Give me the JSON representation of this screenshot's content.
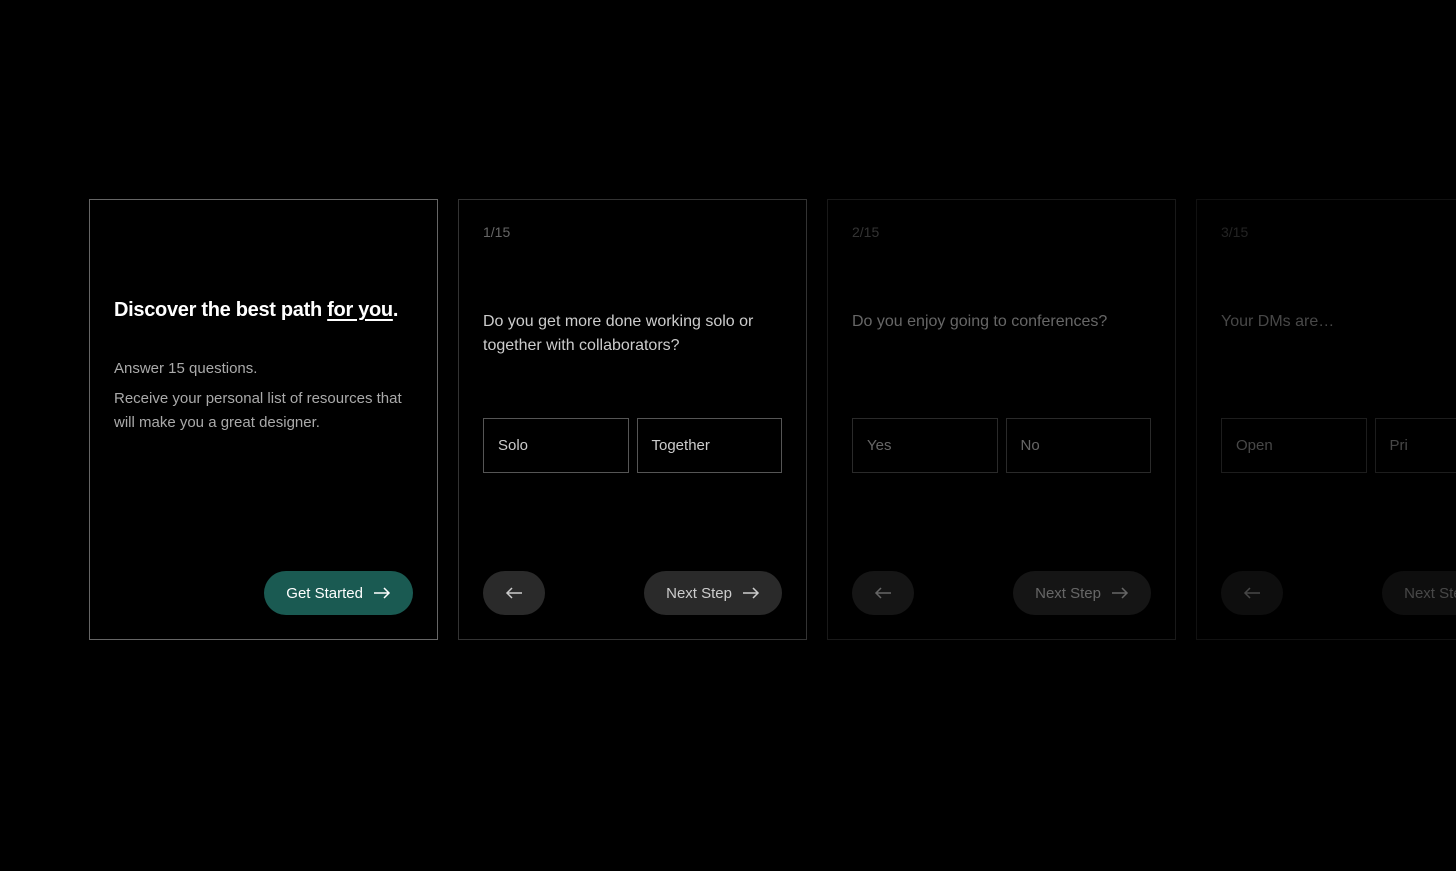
{
  "intro": {
    "title_prefix": "Discover the best path ",
    "title_underline": "for you",
    "title_suffix": ".",
    "line1": "Answer 15 questions.",
    "line2": "Receive your personal list of resources that will make you a great designer.",
    "cta": "Get Started"
  },
  "cards": [
    {
      "progress": "1/15",
      "question": "Do you get more done working solo or together with collaborators?",
      "option_a": "Solo",
      "option_b": "Together",
      "next": "Next Step"
    },
    {
      "progress": "2/15",
      "question": "Do you enjoy going to conferences?",
      "option_a": "Yes",
      "option_b": "No",
      "next": "Next Step"
    },
    {
      "progress": "3/15",
      "question": "Your DMs are…",
      "option_a": "Open",
      "option_b": "Pri",
      "next": "Next Step"
    }
  ]
}
